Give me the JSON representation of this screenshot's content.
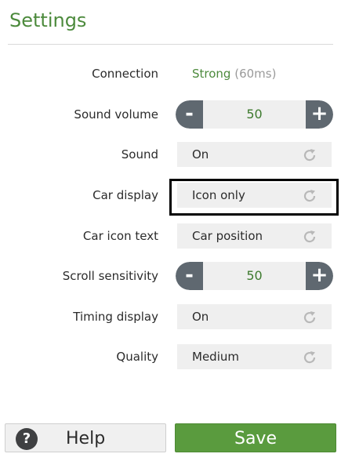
{
  "page": {
    "title": "Settings"
  },
  "settings": {
    "connection": {
      "label": "Connection",
      "status": "Strong",
      "ping": "(60ms)"
    },
    "sound_volume": {
      "label": "Sound volume",
      "value": "50",
      "minus": "-",
      "plus": "+"
    },
    "sound": {
      "label": "Sound",
      "value": "On"
    },
    "car_display": {
      "label": "Car display",
      "value": "Icon only",
      "selected": true
    },
    "car_icon_text": {
      "label": "Car icon text",
      "value": "Car position"
    },
    "scroll_sensitivity": {
      "label": "Scroll sensitivity",
      "value": "50",
      "minus": "-",
      "plus": "+"
    },
    "timing_display": {
      "label": "Timing display",
      "value": "On"
    },
    "quality": {
      "label": "Quality",
      "value": "Medium"
    }
  },
  "footer": {
    "help_icon": "?",
    "help_label": "Help",
    "save_label": "Save"
  },
  "colors": {
    "accent_green": "#4c8a3c",
    "save_button": "#5a9b3e",
    "stepper_button": "#5f6870",
    "selection_border": "#000000"
  },
  "icons": {
    "cycle": "refresh-icon",
    "help": "question-icon"
  }
}
